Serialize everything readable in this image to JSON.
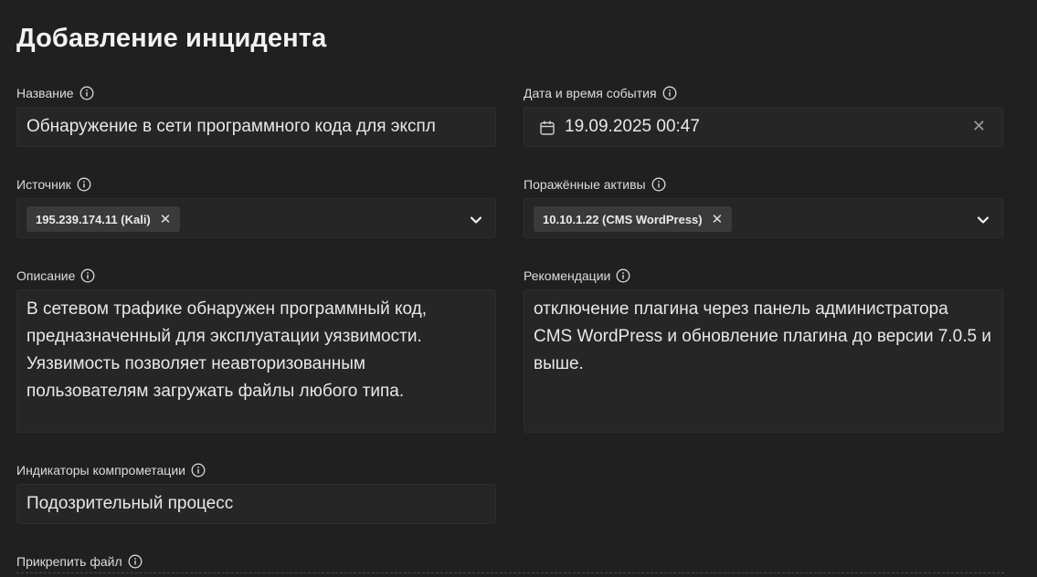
{
  "form": {
    "title": "Добавление инцидента",
    "name": {
      "label": "Название",
      "value": "Обнаружение в сети программного кода для экспл"
    },
    "datetime": {
      "label": "Дата и время события",
      "value": "19.09.2025 00:47"
    },
    "source": {
      "label": "Источник",
      "chips": [
        "195.239.174.11 (Kali)"
      ]
    },
    "assets": {
      "label": "Поражённые активы",
      "chips": [
        "10.10.1.22 (CMS WordPress)"
      ]
    },
    "description": {
      "label": "Описание",
      "value": "В сетевом трафике обнаружен программный код, предназначенный для эксплуатации уязвимости. Уязвимость позволяет неавторизованным пользователям загружать файлы любого типа."
    },
    "recommendations": {
      "label": "Рекомендации",
      "value": "отключение плагина через панель администратора CMS WordPress и обновление плагина до версии 7.0.5 и выше."
    },
    "indicators": {
      "label": "Индикаторы компрометации",
      "value": "Подозрительный процесс"
    },
    "attach": {
      "label": "Прикрепить файл"
    }
  },
  "icons": {
    "info": "info-circle-icon",
    "calendar": "calendar-icon",
    "clear": "close-icon",
    "chevron": "chevron-down-icon",
    "chip_remove": "close-icon"
  }
}
